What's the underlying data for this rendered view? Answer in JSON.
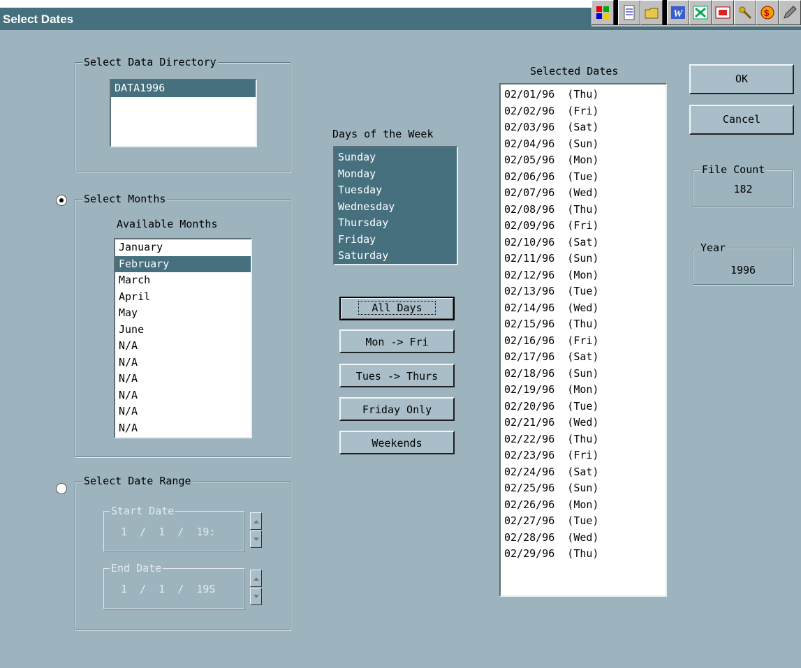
{
  "window": {
    "title": "Select Dates"
  },
  "toolbar_icons": [
    "windows-logo-icon",
    "notepad-icon",
    "folder-icon",
    "word-icon",
    "excel-icon",
    "presentation-icon",
    "keys-icon",
    "money-icon",
    "pen-icon"
  ],
  "data_directory": {
    "legend": "Select Data Directory",
    "items": [
      "DATA1996"
    ],
    "selected": "DATA1996"
  },
  "months": {
    "legend": "Select Months",
    "header": "Available Months",
    "items": [
      "January",
      "February",
      "March",
      "April",
      "May",
      "June",
      "N/A",
      "N/A",
      "N/A",
      "N/A",
      "N/A",
      "N/A"
    ],
    "selected": "February"
  },
  "date_range": {
    "legend": "Select Date Range",
    "start_label": "Start Date",
    "start_value": "1  /  1  /  19:",
    "end_label": "End Date",
    "end_value": "1  /  1  /  19S"
  },
  "days_of_week": {
    "header": "Days of the Week",
    "items": [
      "Sunday",
      "Monday",
      "Tuesday",
      "Wednesday",
      "Thursday",
      "Friday",
      "Saturday"
    ]
  },
  "day_buttons": {
    "all_days": "All Days",
    "mon_fri": "Mon -> Fri",
    "tue_thu": "Tues -> Thurs",
    "friday_only": "Friday Only",
    "weekends": "Weekends"
  },
  "selected_dates": {
    "header": "Selected Dates",
    "items": [
      "02/01/96  (Thu)",
      "02/02/96  (Fri)",
      "02/03/96  (Sat)",
      "02/04/96  (Sun)",
      "02/05/96  (Mon)",
      "02/06/96  (Tue)",
      "02/07/96  (Wed)",
      "02/08/96  (Thu)",
      "02/09/96  (Fri)",
      "02/10/96  (Sat)",
      "02/11/96  (Sun)",
      "02/12/96  (Mon)",
      "02/13/96  (Tue)",
      "02/14/96  (Wed)",
      "02/15/96  (Thu)",
      "02/16/96  (Fri)",
      "02/17/96  (Sat)",
      "02/18/96  (Sun)",
      "02/19/96  (Mon)",
      "02/20/96  (Tue)",
      "02/21/96  (Wed)",
      "02/22/96  (Thu)",
      "02/23/96  (Fri)",
      "02/24/96  (Sat)",
      "02/25/96  (Sun)",
      "02/26/96  (Mon)",
      "02/27/96  (Tue)",
      "02/28/96  (Wed)",
      "02/29/96  (Thu)"
    ]
  },
  "actions": {
    "ok": "OK",
    "cancel": "Cancel"
  },
  "file_count": {
    "legend": "File Count",
    "value": "182"
  },
  "year": {
    "legend": "Year",
    "value": "1996"
  },
  "colors": {
    "background": "#9db4bf",
    "selection": "#46707e",
    "list_background": "#ffffff"
  }
}
